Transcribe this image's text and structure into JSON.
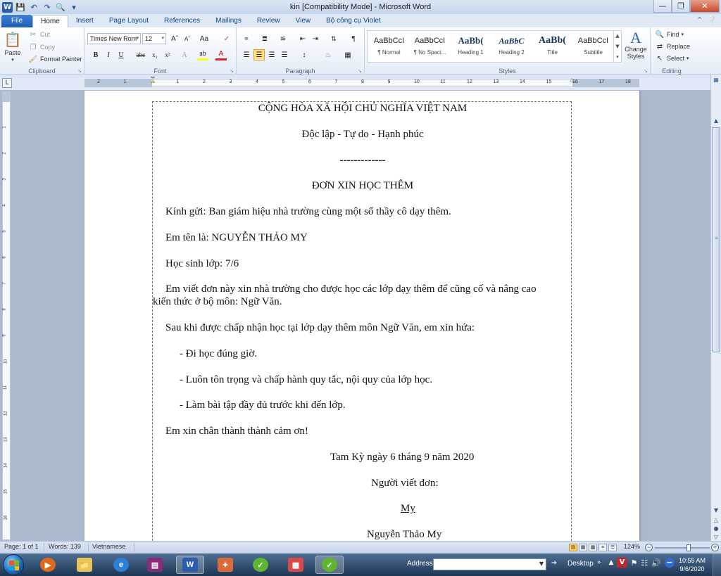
{
  "window": {
    "title": "kin [Compatibility Mode] - Microsoft Word",
    "minimize": "—",
    "restore": "❐",
    "close": "✕"
  },
  "tabs": [
    "File",
    "Home",
    "Insert",
    "Page Layout",
    "References",
    "Mailings",
    "Review",
    "View",
    "Bộ công cụ Violet"
  ],
  "ribbon": {
    "clipboard": {
      "label": "Clipboard",
      "paste": "Paste",
      "cut": "Cut",
      "copy": "Copy",
      "format_painter": "Format Painter"
    },
    "font": {
      "label": "Font",
      "name": "Times New Rom",
      "size": "12"
    },
    "paragraph": {
      "label": "Paragraph"
    },
    "styles": {
      "label": "Styles",
      "items": [
        {
          "preview": "AaBbCcI",
          "name": "¶ Normal"
        },
        {
          "preview": "AaBbCcI",
          "name": "¶ No Spaci..."
        },
        {
          "preview": "AaBb(",
          "name": "Heading 1"
        },
        {
          "preview": "AaBbC",
          "name": "Heading 2"
        },
        {
          "preview": "AaBb(",
          "name": "Title"
        },
        {
          "preview": "AaBbCcI",
          "name": "Subtitle"
        }
      ],
      "change_styles": "Change Styles"
    },
    "editing": {
      "label": "Editing",
      "find": "Find",
      "replace": "Replace",
      "select": "Select"
    }
  },
  "ruler": {
    "numbers": [
      "2",
      "1",
      "1",
      "2",
      "3",
      "4",
      "5",
      "6",
      "7",
      "8",
      "9",
      "10",
      "11",
      "12",
      "13",
      "14",
      "15",
      "16",
      "17",
      "18"
    ],
    "vnumbers": [
      "1",
      "2",
      "3",
      "4",
      "5",
      "6",
      "7",
      "8",
      "9",
      "10",
      "11",
      "12",
      "13",
      "14",
      "15",
      "16",
      "17"
    ]
  },
  "document": {
    "lines": [
      "CỘNG HÒA XÃ HỘI CHỦ NGHĨA VIỆT NAM",
      "Độc lập - Tự do - Hạnh phúc",
      "-------------",
      "ĐƠN XIN HỌC THÊM",
      "Kính gửi: Ban giám hiệu nhà trường cùng một số thầy cô dạy thêm.",
      "Em tên là: NGUYỄN THẢO MY",
      "Học sinh lớp: 7/6",
      "Em viết đơn này xin nhà trường cho được học các lớp dạy thêm để cũng cố và nâng cao",
      "kiến thức ở bộ môn: Ngữ Văn.",
      "Sau khi được chấp nhận học tại lớp dạy thêm môn Ngữ Văn, em xin hứa:",
      "- Đi học đúng giờ.",
      "- Luôn tôn trọng và chấp hành quy tắc, nội quy của lớp học.",
      "- Làm bài tập đầy đủ trước khi đến lớp.",
      "Em xin chân thành thành cảm ơn!",
      "Tam Kỳ ngày 6 tháng 9 năm 2020",
      "Người viết đơn:",
      "My",
      "Nguyễn Thảo My"
    ]
  },
  "status": {
    "page": "Page: 1 of 1",
    "words": "Words: 139",
    "language": "Vietnamese",
    "zoom": "124%",
    "zoom_level": 0.62
  },
  "taskbar": {
    "address_label": "Address",
    "desktop_label": "Desktop",
    "time": "10:55 AM",
    "date": "9/6/2020"
  },
  "colors": {
    "accent": "#2a5db0",
    "ribbon_text": "#15428b"
  }
}
